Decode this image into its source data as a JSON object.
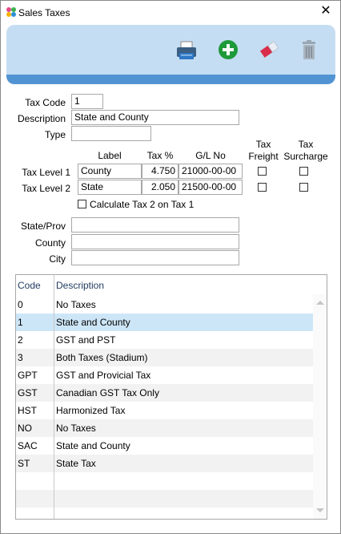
{
  "window": {
    "title": "Sales Taxes",
    "close_label": "✕"
  },
  "toolbar": {
    "icons": [
      "printer-icon",
      "add-icon",
      "eraser-icon",
      "trash-icon"
    ]
  },
  "form": {
    "tax_code_label": "Tax Code",
    "tax_code_value": "1",
    "description_label": "Description",
    "description_value": "State and County",
    "type_label": "Type",
    "type_value": "",
    "headers": {
      "label": "Label",
      "tax_pct": "Tax %",
      "gl_no": "G/L No",
      "tax_freight": "Tax Freight",
      "tax_surcharge": "Tax Surcharge"
    },
    "levels": [
      {
        "name": "Tax Level 1",
        "label": "County",
        "tax": "4.750",
        "gl": "21000-00-00",
        "freight": false,
        "surcharge": false
      },
      {
        "name": "Tax Level 2",
        "label": "State",
        "tax": "2.050",
        "gl": "21500-00-00",
        "freight": false,
        "surcharge": false
      }
    ],
    "calc_tax2_label": "Calculate Tax 2 on Tax 1",
    "calc_tax2_checked": false,
    "state_label": "State/Prov",
    "state_value": "",
    "county_label": "County",
    "county_value": "",
    "city_label": "City",
    "city_value": ""
  },
  "grid": {
    "columns": [
      "Code",
      "Description"
    ],
    "selected_index": 1,
    "rows": [
      {
        "code": "0",
        "description": "No Taxes"
      },
      {
        "code": "1",
        "description": "State and County"
      },
      {
        "code": "2",
        "description": "GST and PST"
      },
      {
        "code": "3",
        "description": "Both Taxes (Stadium)"
      },
      {
        "code": "GPT",
        "description": "GST and Provicial Tax"
      },
      {
        "code": "GST",
        "description": "Canadian GST Tax Only"
      },
      {
        "code": "HST",
        "description": "Harmonized Tax"
      },
      {
        "code": "NO",
        "description": "No Taxes"
      },
      {
        "code": "SAC",
        "description": "State and County"
      },
      {
        "code": "ST",
        "description": "State Tax"
      }
    ]
  },
  "colors": {
    "toolbar_bg": "#c5ddf2",
    "toolbar_strip": "#5294d3",
    "selected_row": "#cde6f7"
  }
}
